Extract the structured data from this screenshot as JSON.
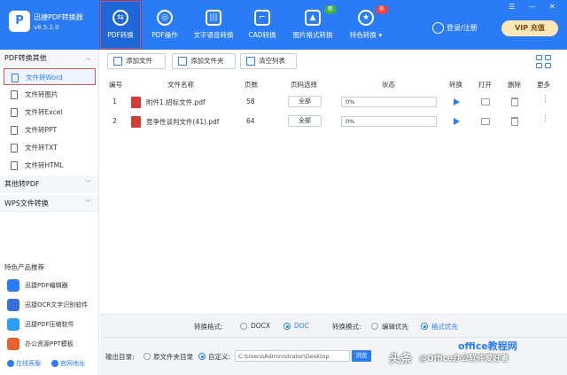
{
  "header": {
    "app_name": "迅捷PDF转换器",
    "version": "v8.5.1.0",
    "tabs": [
      {
        "label": "PDF转换",
        "icon": "convert-icon",
        "active": true
      },
      {
        "label": "PDF操作",
        "icon": "settings-icon",
        "active": false
      },
      {
        "label": "文字语音转换",
        "icon": "waveform-icon",
        "active": false
      },
      {
        "label": "CAD转换",
        "icon": "cad-icon",
        "active": false
      },
      {
        "label": "图片格式转换",
        "icon": "image-icon",
        "active": false,
        "badge": "新"
      },
      {
        "label": "特色转换",
        "icon": "star-icon",
        "active": false,
        "badge": "热"
      }
    ],
    "login_label": "登录/注册",
    "vip_label": "VIP 充值",
    "window_controls": [
      "☰",
      "—",
      "✕"
    ]
  },
  "sidebar": {
    "section_pdf_to_other": "PDF转换其他",
    "items": [
      {
        "label": "文件转Word",
        "active": true
      },
      {
        "label": "文件转图片",
        "active": false
      },
      {
        "label": "文件转Excel",
        "active": false
      },
      {
        "label": "文件转PPT",
        "active": false
      },
      {
        "label": "文件转TXT",
        "active": false
      },
      {
        "label": "文件转HTML",
        "active": false
      }
    ],
    "section_other_to_pdf": "其他转PDF",
    "section_wps": "WPS文件转换",
    "featured_title": "特色产品推荐",
    "featured": [
      {
        "label": "迅捷PDF编辑器",
        "color": "#2a7bf6"
      },
      {
        "label": "迅捷OCR文字识别软件",
        "color": "#3a6fd8"
      },
      {
        "label": "迅捷PDF压缩软件",
        "color": "#2a9df4"
      },
      {
        "label": "办公资源PPT模板",
        "color": "#e8622c"
      }
    ],
    "footer_service": "在线客服",
    "footer_site": "官网地址"
  },
  "toolbar": {
    "add_file": "添加文件",
    "add_folder": "添加文件夹",
    "clear_list": "清空列表"
  },
  "table": {
    "headers": [
      "编号",
      "文件名称",
      "页数",
      "页码选择",
      "状态",
      "转换",
      "打开",
      "删除",
      "更多"
    ],
    "rows": [
      {
        "index": "1",
        "name": "附件1.招标文件.pdf",
        "pages": "58",
        "page_select": "全部",
        "progress": "0%",
        "progress_value": 0
      },
      {
        "index": "2",
        "name": "竞争性谈判文件(41).pdf",
        "pages": "64",
        "page_select": "全部",
        "progress": "0%",
        "progress_value": 0
      }
    ],
    "more_glyph": "⋮"
  },
  "options": {
    "format_label": "转换格式:",
    "format_docx": "DOCX",
    "format_doc": "DOC",
    "mode_label": "转换模式:",
    "mode_edit": "编辑优先",
    "mode_format": "格式优先"
  },
  "output": {
    "label": "输出目录:",
    "source_dir": "原文件夹目录",
    "custom": "自定义:",
    "path": "C:\\Users\\Administrator\\Desktop",
    "browse": "浏览"
  },
  "watermark": {
    "toutiao": "头条",
    "account": "@Office办公软件爱好者",
    "brand": "office教程网"
  },
  "colors": {
    "accent": "#2a7bf6",
    "pdf_red": "#d13c35",
    "active_outline": "#d9534f"
  }
}
